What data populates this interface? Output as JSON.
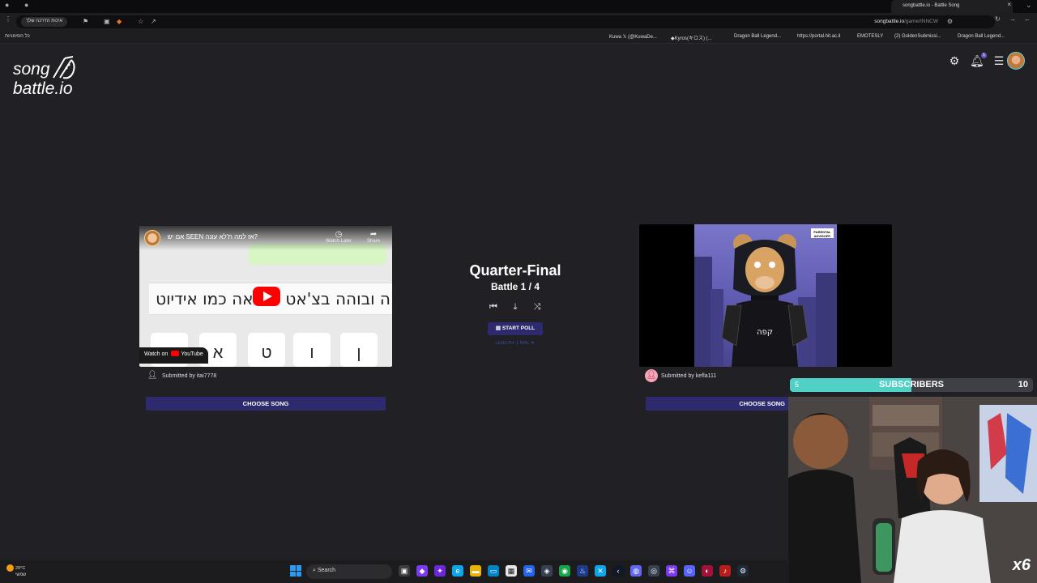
{
  "browser": {
    "active_tab": "songbattle.io - Battle Song",
    "address_url_host": "songbattle.io",
    "address_url_path": "/game/INNCW",
    "address_pill": "איכות הדרכה שלך",
    "all_bookmarks": "כל הסימניות",
    "bookmarks": [
      "Kuwa 𝕏 (@KuwaDe...",
      "◆Kyros(キロス) (...",
      "Dragon Ball Legend...",
      "https://portal.hit.ac.il",
      "EMOTESLY",
      "(2) GoldenSubmissi...",
      "Dragon Ball Legend..."
    ]
  },
  "site": {
    "logo_line1": "song",
    "logo_line2": "battle.io"
  },
  "header": {
    "notification_count": "1"
  },
  "left_song": {
    "video_title": "אם יש SEEN אז למה ת'לא עונה?",
    "watch_later": "Watch Later",
    "share": "Share",
    "typed_text": "ה ובוהה בצ'אט שנראה כמו אידיוט",
    "keyboard_keys": [
      "",
      "א",
      "ט",
      "ו",
      "ן"
    ],
    "watch_on": "Watch on",
    "youtube": "YouTube",
    "submitted_by": "Submitted by itai7778",
    "choose_label": "CHOOSE SONG"
  },
  "right_song": {
    "parental_advisory": "PARENTAL ADVISORY",
    "submitted_by": "Submitted by kefla111",
    "choose_label": "CHOOSE SONG"
  },
  "battle": {
    "round": "Quarter-Final",
    "count": "Battle 1 / 4",
    "start_poll": "START POLL",
    "length": "LENGTH: 1 MIN. ▼"
  },
  "stream": {
    "subs_current": "5",
    "subs_label": "SUBSCRIBERS",
    "subs_goal": "10",
    "subs_fraction": 0.5,
    "multiplier": "x6"
  },
  "taskbar": {
    "temp": "29°C",
    "weather": "שמשי",
    "search_label": "Search"
  },
  "colors": {
    "accent": "#2d2a6e",
    "subs_fill": "#4fd1c5",
    "bg": "#212025"
  }
}
